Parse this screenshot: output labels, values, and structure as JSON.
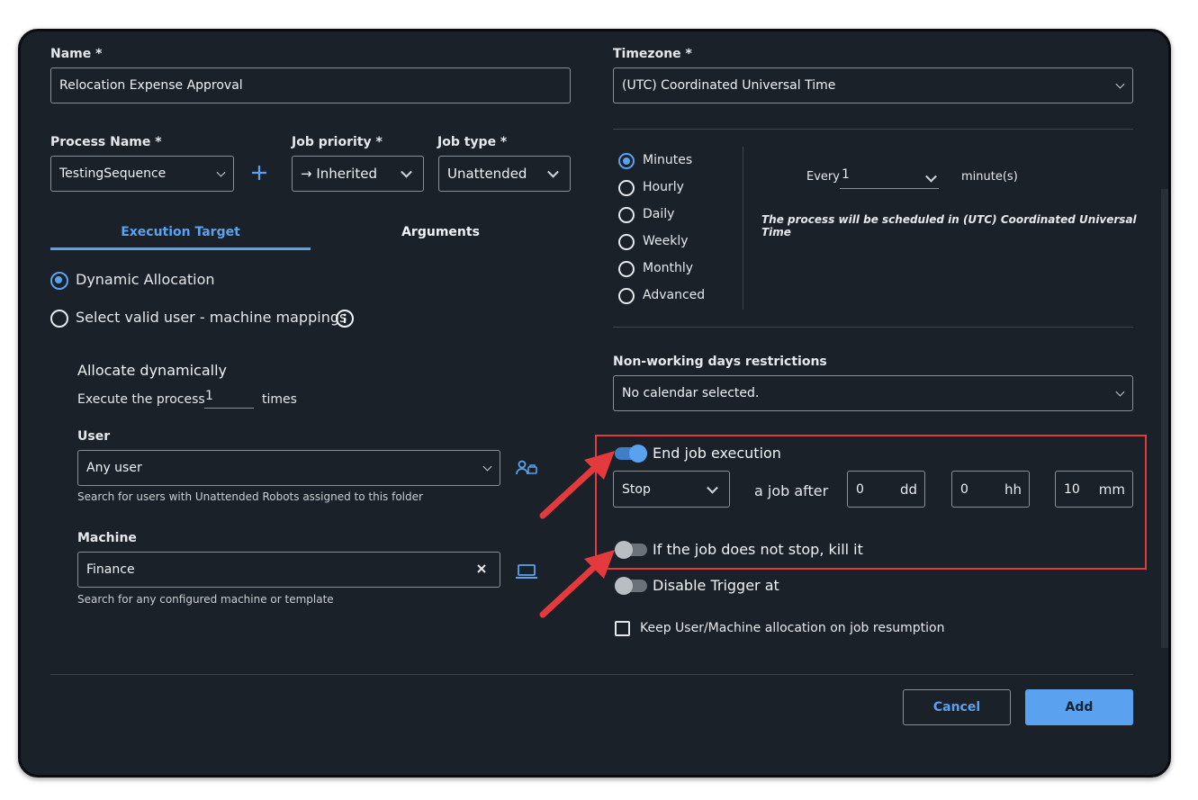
{
  "left": {
    "name_label": "Name *",
    "name_value": "Relocation Expense Approval",
    "process_label": "Process Name *",
    "process_value": "TestingSequence",
    "priority_label": "Job priority *",
    "priority_value": "→ Inherited",
    "jobtype_label": "Job type *",
    "jobtype_value": "Unattended",
    "tabs": [
      {
        "label": "Execution Target"
      },
      {
        "label": "Arguments"
      }
    ],
    "dynamic_label": "Dynamic Allocation",
    "mappings_label": "Select valid user - machine mappings",
    "allocate_title": "Allocate dynamically",
    "execute_label": "Execute the process",
    "execute_value": "1",
    "times_label": "times",
    "user_label": "User",
    "user_value": "Any user",
    "user_help": "Search for users with Unattended Robots assigned to this folder",
    "machine_label": "Machine",
    "machine_value": "Finance",
    "machine_help": "Search for any configured machine or template"
  },
  "right": {
    "timezone_label": "Timezone *",
    "timezone_value": "(UTC) Coordinated Universal Time",
    "frequencies": [
      "Minutes",
      "Hourly",
      "Daily",
      "Weekly",
      "Monthly",
      "Advanced"
    ],
    "every_label": "Every",
    "every_value": "1",
    "unit_label": "minute(s)",
    "schedule_note": "The process will be scheduled in (UTC) Coordinated Universal Time",
    "nonworking_label": "Non-working days restrictions",
    "nonworking_value": "No calendar selected.",
    "end_job_label": "End job execution",
    "end_job_on": true,
    "action_value": "Stop",
    "a_job_after": "a job after",
    "dd_value": "0",
    "dd_unit": "dd",
    "hh_value": "0",
    "hh_unit": "hh",
    "mm_value": "10",
    "mm_unit": "mm",
    "kill_label": "If the job does not stop, kill it",
    "kill_on": false,
    "disable_label": "Disable Trigger at",
    "disable_on": false,
    "keep_label": "Keep User/Machine allocation on job resumption",
    "keep_checked": false
  },
  "footer": {
    "cancel_label": "Cancel",
    "add_label": "Add"
  },
  "colors": {
    "accent": "#5aa2f0",
    "highlight": "#e4393d",
    "background": "#1b2128"
  }
}
